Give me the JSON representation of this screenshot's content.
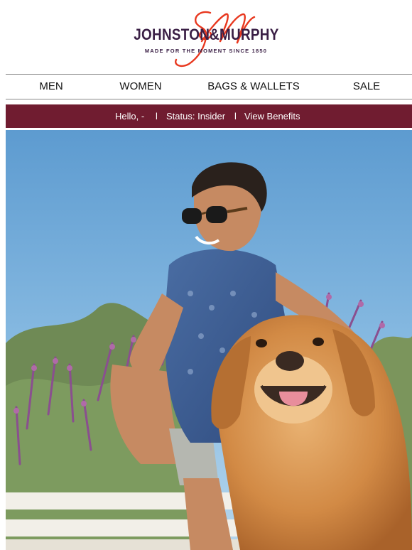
{
  "brand": {
    "name": "JOHNSTON & MURPHY",
    "wordmark": "JOHNSTON&MURPHY",
    "tagline": "MADE FOR THE MOMENT SINCE 1850",
    "monogram_icon": "jm-script-monogram-icon",
    "colors": {
      "wordmark": "#3a1f45",
      "monogram": "#e8381f",
      "member_bar": "#701c30"
    }
  },
  "nav": {
    "items": [
      {
        "label": "MEN"
      },
      {
        "label": "WOMEN"
      },
      {
        "label": "BAGS & WALLETS"
      },
      {
        "label": "SALE"
      }
    ]
  },
  "member_bar": {
    "greeting": "Hello, -",
    "separator": "l",
    "status": "Status: Insider",
    "benefits_link": "View Benefits"
  },
  "hero": {
    "image": "smiling-man-in-sunglasses-with-golden-retriever-photo"
  }
}
